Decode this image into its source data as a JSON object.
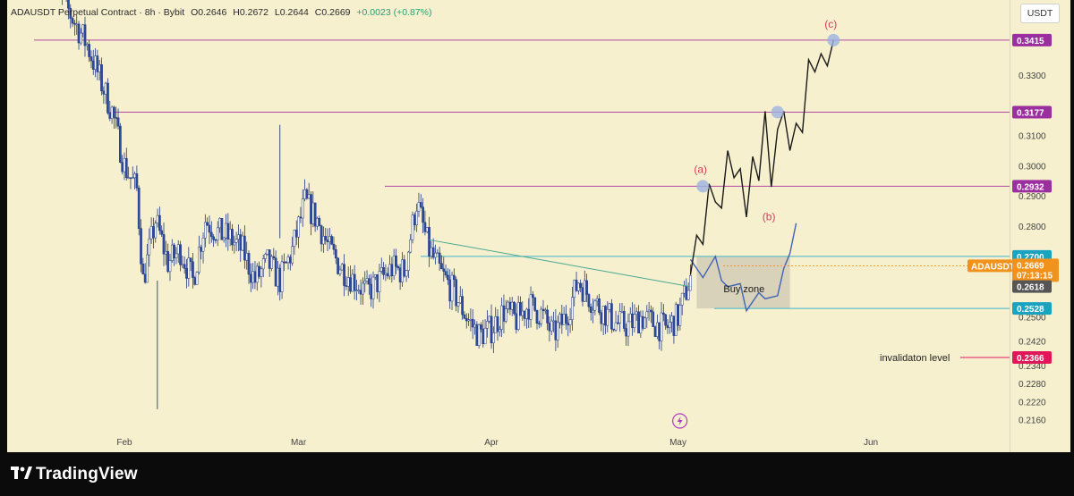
{
  "header": {
    "symbol": "ADAUSDT Perpetual Contract · 8h · Bybit",
    "open": "O0.2646",
    "high": "H0.2672",
    "low": "L0.2644",
    "close": "C0.2669",
    "change": "+0.0023 (+0.87%)"
  },
  "currency": "USDT",
  "brand": {
    "name": "TradingView"
  },
  "colors": {
    "resistance_line": "#b24aa4",
    "resistance_badge": "#9c2fa0",
    "support_line": "#3fb6c8",
    "support_badge": "#1aa3c0",
    "price_badge": "#f0921b",
    "invalidation_badge": "#e0185a",
    "candle_up": "#ffffff",
    "candle_down": "#2c4aa0",
    "background": "#f6f0cf"
  },
  "chart_data": {
    "type": "candlestick",
    "instrument": "ADAUSDT",
    "timeframe": "8h",
    "y_axis": {
      "scale": "price",
      "ylim": [
        0.214,
        0.352
      ],
      "tick_labels": [
        "0.3300",
        "0.3100",
        "0.3000",
        "0.2900",
        "0.2800",
        "0.2500",
        "0.2420",
        "0.2340",
        "0.2280",
        "0.2220",
        "0.2160"
      ],
      "tick_values": [
        0.33,
        0.31,
        0.3,
        0.29,
        0.28,
        0.25,
        0.242,
        0.234,
        0.228,
        0.222,
        0.216
      ]
    },
    "x_axis": {
      "tick_labels": [
        "Feb",
        "Mar",
        "Apr",
        "May",
        "Jun"
      ],
      "tick_day": [
        0,
        28,
        59,
        89,
        120
      ]
    },
    "levels": [
      {
        "price": 0.3415,
        "label": "0.3415",
        "kind": "resistance"
      },
      {
        "price": 0.3177,
        "label": "0.3177",
        "kind": "resistance"
      },
      {
        "price": 0.2932,
        "label": "0.2932",
        "kind": "resistance"
      },
      {
        "price": 0.27,
        "label": "0.2700",
        "kind": "support"
      },
      {
        "price": 0.2528,
        "label": "0.2528",
        "kind": "support"
      }
    ],
    "current_price": {
      "label": "ADAUSDT.P",
      "price": "0.2669",
      "countdown": "07:13:15",
      "price_value": 0.2669
    },
    "secondary_price": {
      "price": "0.2618",
      "price_value": 0.2618
    },
    "invalidation": {
      "price": 0.2366,
      "label": "0.2366",
      "text": "invalidaton level"
    },
    "buy_zone": {
      "text": "Buy zone",
      "price_top": 0.27,
      "price_bottom": 0.2528,
      "day_start": 92,
      "day_end": 107
    },
    "trendline": {
      "from": {
        "day": 49,
        "price": 0.2755
      },
      "to": {
        "day": 91,
        "price": 0.26
      }
    },
    "wave_labels": [
      {
        "text": "(a)",
        "day": 93,
        "price": 0.2935
      },
      {
        "text": "(b)",
        "day": 104,
        "price": 0.289
      },
      {
        "text": "(c)",
        "day": 114,
        "price": 0.3415
      }
    ],
    "candles_summary": {
      "start_day": -12,
      "end_day": 91,
      "path_days": [
        -12,
        -10,
        -6,
        -2,
        0,
        2,
        3,
        5,
        7,
        9,
        11,
        13,
        15,
        17,
        19,
        21,
        23,
        25,
        27,
        29,
        31,
        33,
        35,
        37,
        39,
        41,
        43,
        45,
        47,
        49,
        51,
        53,
        55,
        57,
        59,
        61,
        63,
        65,
        67,
        69,
        71,
        73,
        75,
        77,
        79,
        81,
        83,
        85,
        87,
        89,
        91
      ],
      "path_closes": [
        0.372,
        0.355,
        0.34,
        0.318,
        0.3,
        0.292,
        0.262,
        0.282,
        0.268,
        0.272,
        0.262,
        0.282,
        0.278,
        0.276,
        0.272,
        0.262,
        0.268,
        0.262,
        0.272,
        0.288,
        0.282,
        0.272,
        0.266,
        0.262,
        0.258,
        0.262,
        0.266,
        0.265,
        0.288,
        0.272,
        0.264,
        0.258,
        0.25,
        0.244,
        0.246,
        0.252,
        0.249,
        0.254,
        0.251,
        0.244,
        0.25,
        0.262,
        0.256,
        0.252,
        0.248,
        0.247,
        0.25,
        0.248,
        0.246,
        0.25,
        0.263
      ]
    },
    "projection_path": [
      {
        "day": 91,
        "price": 0.264
      },
      {
        "day": 92,
        "price": 0.277
      },
      {
        "day": 93,
        "price": 0.274
      },
      {
        "day": 94,
        "price": 0.294
      },
      {
        "day": 95,
        "price": 0.288
      },
      {
        "day": 96,
        "price": 0.286
      },
      {
        "day": 97,
        "price": 0.305
      },
      {
        "day": 98,
        "price": 0.296
      },
      {
        "day": 99,
        "price": 0.299
      },
      {
        "day": 100,
        "price": 0.283
      },
      {
        "day": 101,
        "price": 0.303
      },
      {
        "day": 102,
        "price": 0.295
      },
      {
        "day": 103,
        "price": 0.318
      },
      {
        "day": 104,
        "price": 0.293
      },
      {
        "day": 105,
        "price": 0.312
      },
      {
        "day": 106,
        "price": 0.318
      },
      {
        "day": 107,
        "price": 0.305
      },
      {
        "day": 108,
        "price": 0.314
      },
      {
        "day": 109,
        "price": 0.311
      },
      {
        "day": 110,
        "price": 0.335
      },
      {
        "day": 111,
        "price": 0.331
      },
      {
        "day": 112,
        "price": 0.337
      },
      {
        "day": 113,
        "price": 0.333
      },
      {
        "day": 114,
        "price": 0.3415
      }
    ],
    "blue_projection": [
      {
        "day": 91,
        "price": 0.269
      },
      {
        "day": 93,
        "price": 0.263
      },
      {
        "day": 95,
        "price": 0.27
      },
      {
        "day": 96,
        "price": 0.262
      },
      {
        "day": 97,
        "price": 0.26
      },
      {
        "day": 99,
        "price": 0.261
      },
      {
        "day": 100,
        "price": 0.252
      },
      {
        "day": 102,
        "price": 0.258
      },
      {
        "day": 103,
        "price": 0.256
      },
      {
        "day": 105,
        "price": 0.257
      },
      {
        "day": 106,
        "price": 0.266
      },
      {
        "day": 107,
        "price": 0.271
      },
      {
        "day": 108,
        "price": 0.281
      }
    ],
    "markers": [
      {
        "day": 93,
        "price": 0.2932
      },
      {
        "day": 105,
        "price": 0.3177
      },
      {
        "day": 114,
        "price": 0.3415
      }
    ]
  }
}
